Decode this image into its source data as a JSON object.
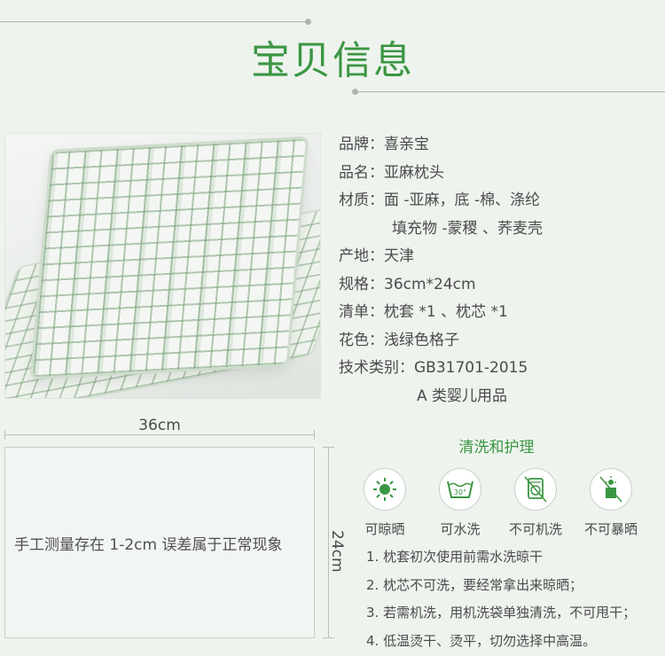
{
  "header": {
    "title": "宝贝信息"
  },
  "info": {
    "rows": [
      "品牌：喜亲宝",
      "品名：亚麻枕头",
      "材质：面 -亚麻，底 -棉、涤纶",
      "填充物 -蒙稷 、荞麦壳",
      "产地：天津",
      "规格：36cm*24cm",
      "清单：枕套 *1 、枕芯 *1",
      "花色：浅绿色格子",
      "技术类别：GB31701-2015",
      "A 类婴儿用品"
    ]
  },
  "dimensions": {
    "width_label": "36cm",
    "height_label": "24cm",
    "note": "手工测量存在 1-2cm 误差属于正常现象"
  },
  "care": {
    "title": "清洗和护理",
    "icons": [
      {
        "label": "可晾晒",
        "icon": "sun-drying-icon"
      },
      {
        "label": "可水洗",
        "icon": "hand-wash-30-icon",
        "temp": "30°"
      },
      {
        "label": "不可机洗",
        "icon": "no-machine-wash-icon"
      },
      {
        "label": "不可暴晒",
        "icon": "no-sun-exposure-icon"
      }
    ],
    "instructions": [
      "1. 枕套初次使用前需水洗晾干",
      "2. 枕芯不可洗，要经常拿出来晾晒；",
      "3. 若需机洗，用机洗袋单独清洗，不可甩干；",
      "4. 低温烫干、烫平，切勿选择中高温。"
    ]
  },
  "colors": {
    "accent": "#3b9643",
    "background": "#eef3ee"
  }
}
